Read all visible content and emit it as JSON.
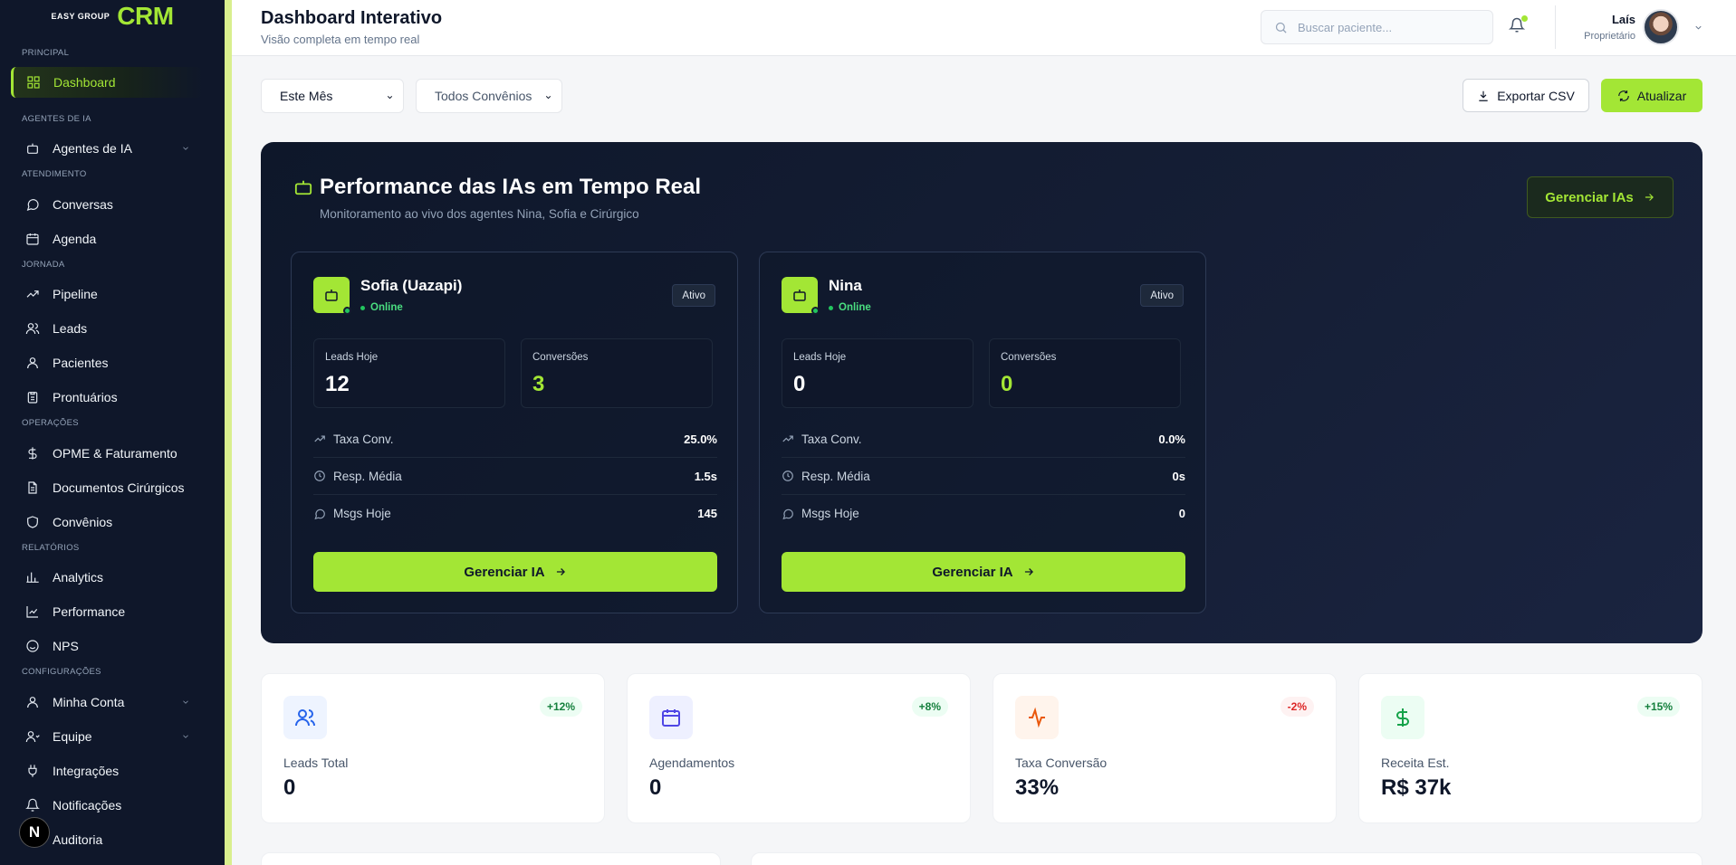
{
  "brand": {
    "mark": "EASY GROUP",
    "name": "CRM"
  },
  "sidebar": {
    "sections": [
      {
        "label": "Principal"
      },
      {
        "label": "Agentes de IA"
      },
      {
        "label": "Atendimento"
      },
      {
        "label": "Jornada"
      },
      {
        "label": "Operações"
      },
      {
        "label": "Relatórios"
      },
      {
        "label": "Configurações"
      }
    ],
    "items": [
      {
        "label": "Dashboard",
        "icon": "grid-icon",
        "active": true
      },
      {
        "label": "Agentes de IA",
        "icon": "bot-icon",
        "expandable": true
      },
      {
        "label": "Conversas",
        "icon": "chat-icon"
      },
      {
        "label": "Agenda",
        "icon": "calendar-icon"
      },
      {
        "label": "Pipeline",
        "icon": "trending-icon"
      },
      {
        "label": "Leads",
        "icon": "users-icon"
      },
      {
        "label": "Pacientes",
        "icon": "user-icon"
      },
      {
        "label": "Prontuários",
        "icon": "clipboard-icon"
      },
      {
        "label": "OPME & Faturamento",
        "icon": "dollar-icon"
      },
      {
        "label": "Documentos Cirúrgicos",
        "icon": "file-icon"
      },
      {
        "label": "Convênios",
        "icon": "shield-icon"
      },
      {
        "label": "Analytics",
        "icon": "bar-chart-icon"
      },
      {
        "label": "Performance",
        "icon": "line-chart-icon"
      },
      {
        "label": "NPS",
        "icon": "smile-icon"
      },
      {
        "label": "Minha Conta",
        "icon": "user-icon",
        "expandable": true
      },
      {
        "label": "Equipe",
        "icon": "team-icon",
        "expandable": true
      },
      {
        "label": "Integrações",
        "icon": "plug-icon"
      },
      {
        "label": "Notificações",
        "icon": "bell-icon"
      },
      {
        "label": "Auditoria",
        "icon": "audit-icon"
      }
    ],
    "badge": "N"
  },
  "header": {
    "title": "Dashboard Interativo",
    "subtitle": "Visão completa em tempo real",
    "search_placeholder": "Buscar paciente...",
    "user": {
      "name": "Laís",
      "role": "Proprietário"
    }
  },
  "toolbar": {
    "period": "Este Mês",
    "insurance": "Todos Convênios",
    "export_label": "Exportar CSV",
    "refresh_label": "Atualizar"
  },
  "hero": {
    "title": "Performance das IAs em Tempo Real",
    "subtitle": "Monitoramento ao vivo dos agentes Nina, Sofia e Cirúrgico",
    "manage_all_label": "Gerenciar IAs",
    "agents": [
      {
        "name": "Sofia (Uazapi)",
        "status": "Online",
        "badge": "Ativo",
        "leads_label": "Leads Hoje",
        "leads": "12",
        "conv_label": "Conversões",
        "conversions": "3",
        "metrics": [
          {
            "label": "Taxa Conv.",
            "value": "25.0%",
            "icon": "trending-icon"
          },
          {
            "label": "Resp. Média",
            "value": "1.5s",
            "icon": "clock-icon"
          },
          {
            "label": "Msgs Hoje",
            "value": "145",
            "icon": "chat-icon"
          }
        ],
        "button": "Gerenciar IA"
      },
      {
        "name": "Nina",
        "status": "Online",
        "badge": "Ativo",
        "leads_label": "Leads Hoje",
        "leads": "0",
        "conv_label": "Conversões",
        "conversions": "0",
        "metrics": [
          {
            "label": "Taxa Conv.",
            "value": "0.0%",
            "icon": "trending-icon"
          },
          {
            "label": "Resp. Média",
            "value": "0s",
            "icon": "clock-icon"
          },
          {
            "label": "Msgs Hoje",
            "value": "0",
            "icon": "chat-icon"
          }
        ],
        "button": "Gerenciar IA"
      }
    ]
  },
  "kpis": [
    {
      "label": "Leads Total",
      "value": "0",
      "delta": "+12%",
      "icon": "users-icon",
      "tone": "#2563eb",
      "bg": "#eef4ff",
      "delta_color": "#15803d",
      "delta_bg": "#ecfdf3"
    },
    {
      "label": "Agendamentos",
      "value": "0",
      "delta": "+8%",
      "icon": "calendar-icon",
      "tone": "#4f46e5",
      "bg": "#eef0ff",
      "delta_color": "#15803d",
      "delta_bg": "#ecfdf3"
    },
    {
      "label": "Taxa Conversão",
      "value": "33%",
      "delta": "-2%",
      "icon": "activity-icon",
      "tone": "#ea580c",
      "bg": "#fff4ec",
      "delta_color": "#dc2626",
      "delta_bg": "#fef2f2"
    },
    {
      "label": "Receita Est.",
      "value": "R$ 37k",
      "delta": "+15%",
      "icon": "dollar-icon",
      "tone": "#16a34a",
      "bg": "#ecfdf3",
      "delta_color": "#15803d",
      "delta_bg": "#ecfdf3"
    }
  ]
}
